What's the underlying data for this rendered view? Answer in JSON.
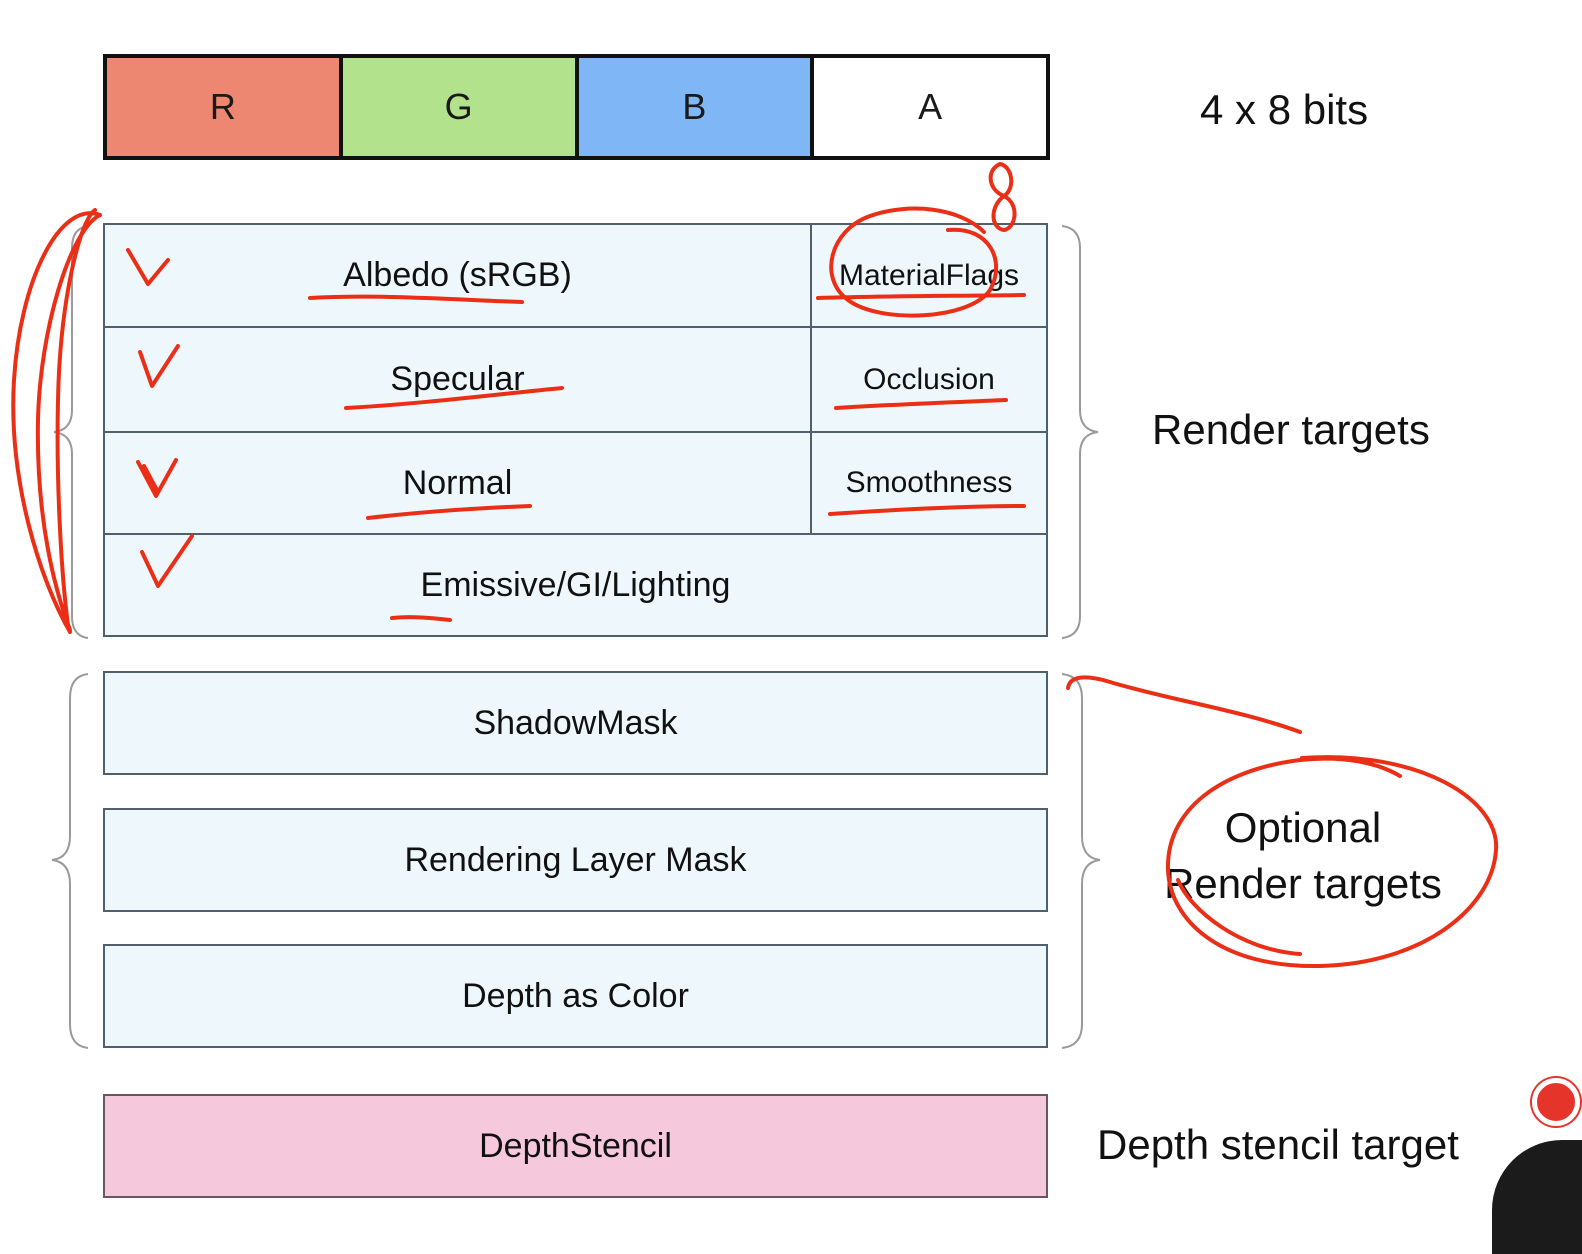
{
  "rgba": {
    "channels": [
      {
        "label": "R",
        "color": "#ee8771"
      },
      {
        "label": "G",
        "color": "#b2e28b"
      },
      {
        "label": "B",
        "color": "#7fb6f6"
      },
      {
        "label": "A",
        "color": "#ffffff"
      }
    ],
    "size_label": "4 x 8 bits"
  },
  "render_targets": {
    "rows": [
      {
        "main": "Albedo (sRGB)",
        "alpha": "MaterialFlags"
      },
      {
        "main": "Specular",
        "alpha": "Occlusion"
      },
      {
        "main": "Normal",
        "alpha": "Smoothness"
      },
      {
        "main": "Emissive/GI/Lighting"
      }
    ],
    "group_label": "Render targets",
    "cell_color": "#eef8fc"
  },
  "optional_targets": {
    "rows": [
      "ShadowMask",
      "Rendering Layer Mask",
      "Depth as Color"
    ],
    "group_label_line1": "Optional",
    "group_label_line2": "Render targets"
  },
  "depth": {
    "label": "DepthStencil",
    "target_label": "Depth stencil target",
    "color": "#f6c8dc"
  },
  "annotations": {
    "ink_color": "#ea2f16",
    "handwritten_number": "8"
  }
}
